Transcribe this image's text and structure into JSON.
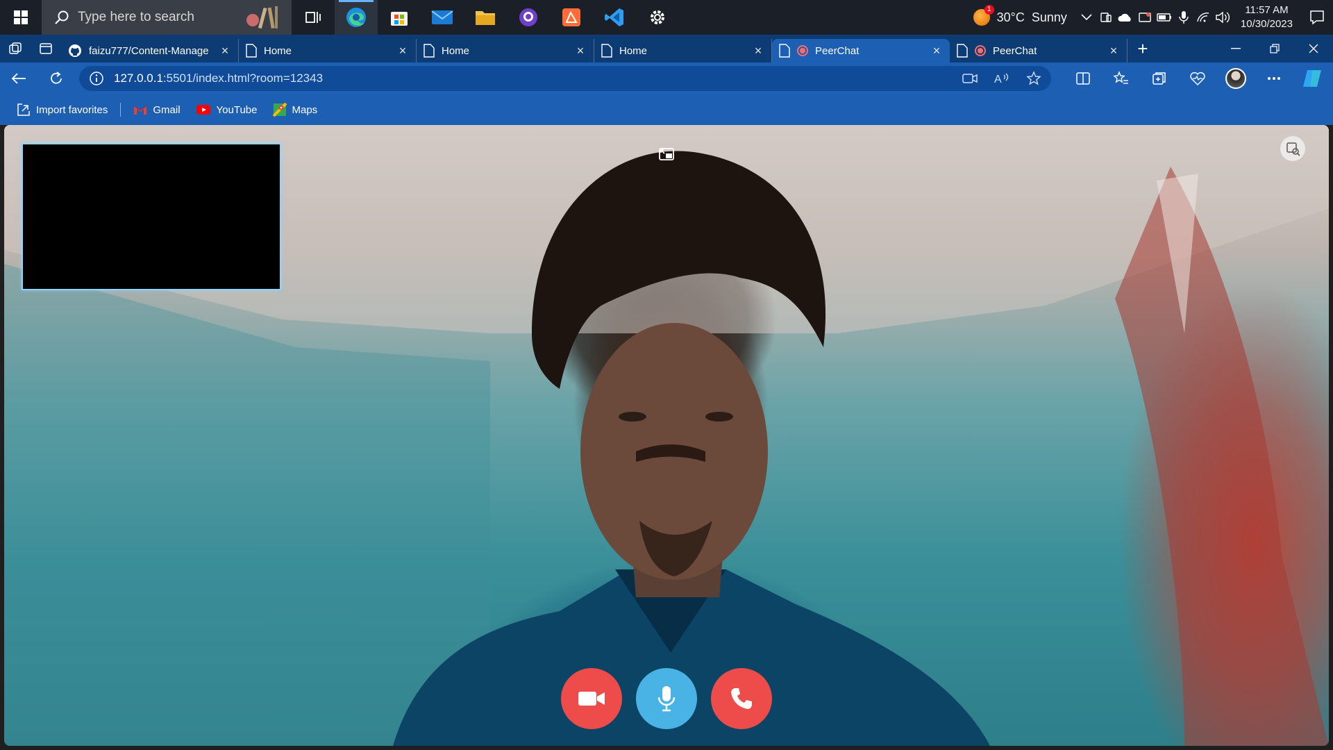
{
  "taskbar": {
    "search_placeholder": "Type here to search",
    "apps": [
      "task-view",
      "edge",
      "microsoft-store",
      "mail",
      "file-explorer",
      "github-desktop",
      "postman",
      "vscode",
      "settings"
    ],
    "weather": {
      "temp": "30°C",
      "condition": "Sunny",
      "badge": "1"
    },
    "clock": {
      "time": "11:57 AM",
      "date": "10/30/2023"
    }
  },
  "browser": {
    "tabs": [
      {
        "label": "faizu777/Content-Manage",
        "icon": "github-icon"
      },
      {
        "label": "Home",
        "icon": "page-icon"
      },
      {
        "label": "Home",
        "icon": "page-icon"
      },
      {
        "label": "Home",
        "icon": "page-icon"
      },
      {
        "label": "PeerChat",
        "icon": "page-icon",
        "active": true
      },
      {
        "label": "PeerChat",
        "icon": "page-icon"
      }
    ],
    "address": {
      "host": "127.0.0.1",
      "rest": ":5501/index.html?room=12343"
    },
    "favorites": [
      {
        "label": "Import favorites"
      },
      {
        "label": "Gmail"
      },
      {
        "label": "YouTube"
      },
      {
        "label": "Maps"
      }
    ]
  },
  "call": {
    "controls": [
      "camera",
      "microphone",
      "hang-up"
    ],
    "colors": {
      "camera": "#ee4b4b",
      "microphone": "#4ab3e6",
      "hangup": "#ee4b4b",
      "local_border": "#8fd3ff"
    }
  }
}
